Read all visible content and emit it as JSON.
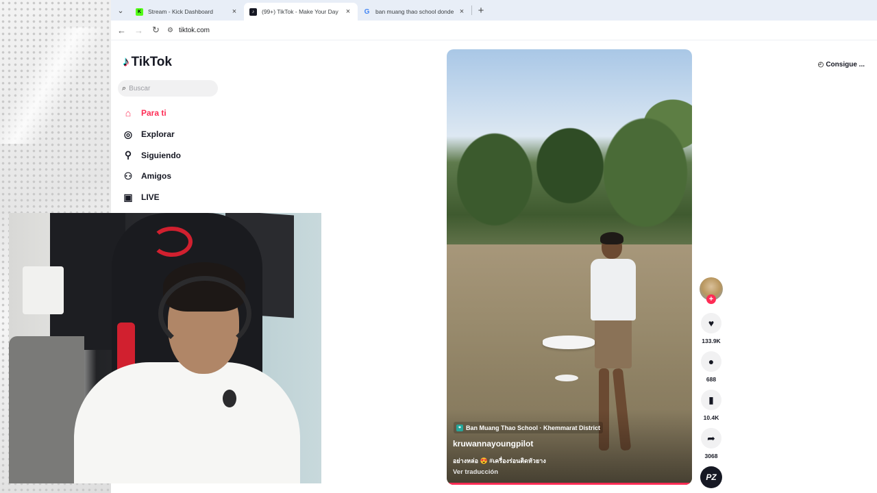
{
  "browser": {
    "tabs": [
      {
        "title": "Stream - Kick Dashboard",
        "favicon": "kick",
        "favicon_color": "#53fc18",
        "active": false
      },
      {
        "title": "(99+) TikTok - Make Your Day",
        "favicon": "tiktok",
        "favicon_color": "#161823",
        "active": true
      },
      {
        "title": "ban muang thao school donde",
        "favicon": "google",
        "favicon_color": "#4285f4",
        "active": false
      }
    ],
    "url": "tiktok.com"
  },
  "tiktok": {
    "logo_text": "TikTok",
    "search_placeholder": "Buscar",
    "nav": [
      {
        "label": "Para ti",
        "icon": "home-icon",
        "active": true
      },
      {
        "label": "Explorar",
        "icon": "compass-icon",
        "active": false
      },
      {
        "label": "Siguiendo",
        "icon": "following-icon",
        "active": false
      },
      {
        "label": "Amigos",
        "icon": "friends-icon",
        "active": false
      },
      {
        "label": "LIVE",
        "icon": "live-icon",
        "active": false
      }
    ],
    "get_app_label": "Consigue ...",
    "accent_color": "#fe2c55",
    "video": {
      "location": "Ban Muang Thao School · Khemmarat District",
      "author": "kruwannayoungpilot",
      "caption": "อย่างหล่อ 😍 #เครื่องร่อนติดหัวยาง",
      "translate_label": "Ver traducción"
    },
    "actions": {
      "likes": "133.9K",
      "comments": "688",
      "saves": "10.4K",
      "shares": "3068"
    },
    "music_badge": "PZ"
  }
}
